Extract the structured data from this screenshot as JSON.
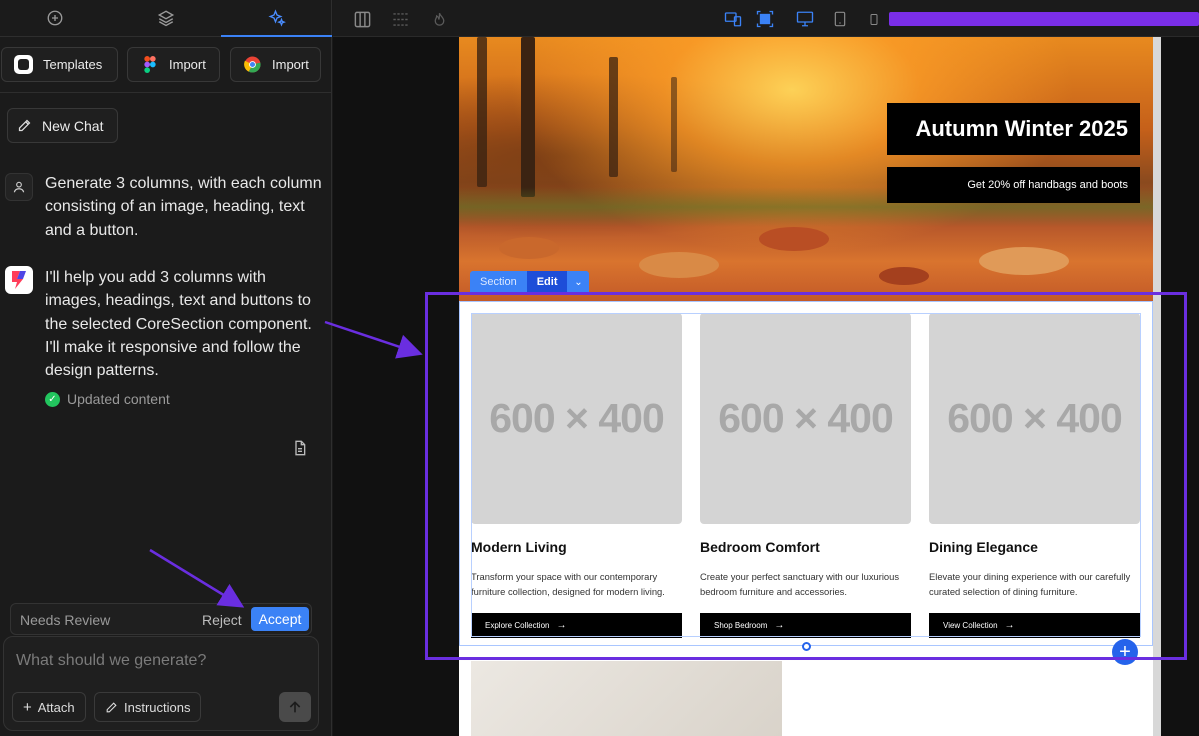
{
  "left_panel": {
    "tabs": [
      {
        "icon": "plus-circle-icon",
        "active": false
      },
      {
        "icon": "layers-icon",
        "active": false
      },
      {
        "icon": "sparkles-icon",
        "active": true
      }
    ],
    "buttons": {
      "templates": "Templates",
      "figma_import": "Import",
      "chrome_import": "Import"
    },
    "new_chat": "New Chat",
    "messages": {
      "user": "Generate 3 columns, with each column consisting of an image, heading, text and a button.",
      "assistant": "I'll help you add 3 columns with images, headings, text and buttons to the selected CoreSection component. I'll make it responsive and follow the design patterns.",
      "status": "Updated content"
    },
    "review": {
      "label": "Needs Review",
      "reject": "Reject",
      "accept": "Accept"
    },
    "composer": {
      "placeholder": "What should we generate?",
      "attach": "Attach",
      "instructions": "Instructions"
    }
  },
  "canvas": {
    "hero": {
      "title": "Autumn Winter 2025",
      "subtitle": "Get 20% off handbags and boots"
    },
    "section_tag": {
      "label": "Section",
      "edit": "Edit"
    },
    "columns": [
      {
        "placeholder": "600 × 400",
        "heading": "Modern Living",
        "text": "Transform your space with our contemporary furniture collection, designed for modern living.",
        "button": "Explore Collection"
      },
      {
        "placeholder": "600 × 400",
        "heading": "Bedroom Comfort",
        "text": "Create your perfect sanctuary with our luxurious bedroom furniture and accessories.",
        "button": "Shop Bedroom"
      },
      {
        "placeholder": "600 × 400",
        "heading": "Dining Elegance",
        "text": "Elevate your dining experience with our carefully curated selection of dining furniture.",
        "button": "View Collection"
      }
    ]
  },
  "colors": {
    "accent": "#3b82f6",
    "annotation": "#6a2ee0",
    "success": "#22c55e"
  }
}
